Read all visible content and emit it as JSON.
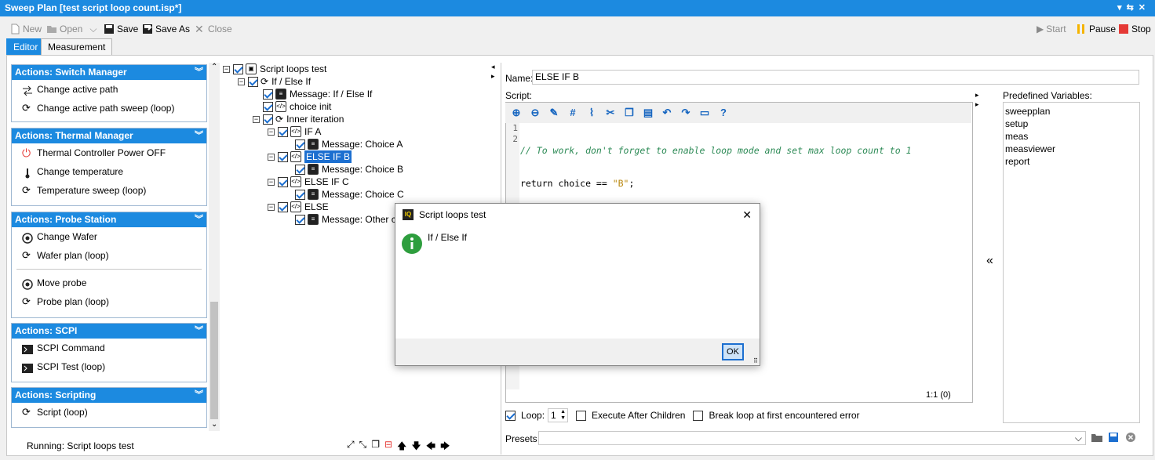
{
  "window": {
    "title": "Sweep Plan [test script loop count.isp*]"
  },
  "toolbar": {
    "new": "New",
    "open": "Open",
    "save": "Save",
    "save_as": "Save As",
    "close": "Close",
    "start": "Start",
    "pause": "Pause",
    "stop": "Stop"
  },
  "tabs": [
    {
      "label": "Editor",
      "active": true
    },
    {
      "label": "Measurement",
      "active": false
    }
  ],
  "groups": [
    {
      "title": "Actions: Switch Manager",
      "items": [
        "Change active path",
        "Change active path sweep (loop)"
      ]
    },
    {
      "title": "Actions: Thermal Manager",
      "items": [
        "Thermal Controller Power OFF",
        "Change temperature",
        "Temperature sweep (loop)"
      ]
    },
    {
      "title": "Actions: Probe Station",
      "items": [
        "Change Wafer",
        "Wafer plan (loop)",
        "Move probe",
        "Probe plan (loop)"
      ]
    },
    {
      "title": "Actions: SCPI",
      "items": [
        "SCPI Command",
        "SCPI Test (loop)"
      ]
    },
    {
      "title": "Actions: Scripting",
      "items": [
        "Script (loop)"
      ]
    }
  ],
  "status": {
    "text": "Running: Script loops test"
  },
  "tree": [
    {
      "label": "Script loops test",
      "level": 0
    },
    {
      "label": "If / Else If",
      "level": 1
    },
    {
      "label": "Message: If / Else If",
      "level": 2
    },
    {
      "label": "choice init",
      "level": 2
    },
    {
      "label": "Inner iteration",
      "level": 2
    },
    {
      "label": "IF A",
      "level": 3
    },
    {
      "label": "Message: Choice A",
      "level": 4
    },
    {
      "label": "ELSE IF B",
      "level": 3,
      "selected": true
    },
    {
      "label": "Message: Choice B",
      "level": 4
    },
    {
      "label": "ELSE IF C",
      "level": 3
    },
    {
      "label": "Message: Choice C",
      "level": 4
    },
    {
      "label": "ELSE",
      "level": 3
    },
    {
      "label": "Message: Other ch",
      "level": 4
    }
  ],
  "editor": {
    "name_label": "Name:",
    "name_value": "ELSE IF B",
    "script_label": "Script:",
    "line1_num": "1",
    "line1": "// To work, don't forget to enable loop mode and set max loop count to 1",
    "line2_num": "2",
    "line2_pre": "return choice == ",
    "line2_str": "\"B\"",
    "line2_post": ";",
    "cursor": "1:1 (0)"
  },
  "variables": {
    "label": "Predefined Variables:",
    "items": [
      "sweepplan",
      "setup",
      "meas",
      "measviewer",
      "report"
    ]
  },
  "loop": {
    "loop_label": "Loop:",
    "loop_count": "1",
    "execute_after": "Execute After Children",
    "break_loop": "Break loop at first encountered error"
  },
  "presets": {
    "label": "Presets"
  },
  "dialog": {
    "title": "Script loops test",
    "message": "If / Else If",
    "ok": "OK"
  },
  "colors": {
    "accent": "#1c8ae0",
    "selection": "#1c6fd0",
    "pause": "#f5b400",
    "stop": "#e53935",
    "info": "#2e9e3e"
  }
}
